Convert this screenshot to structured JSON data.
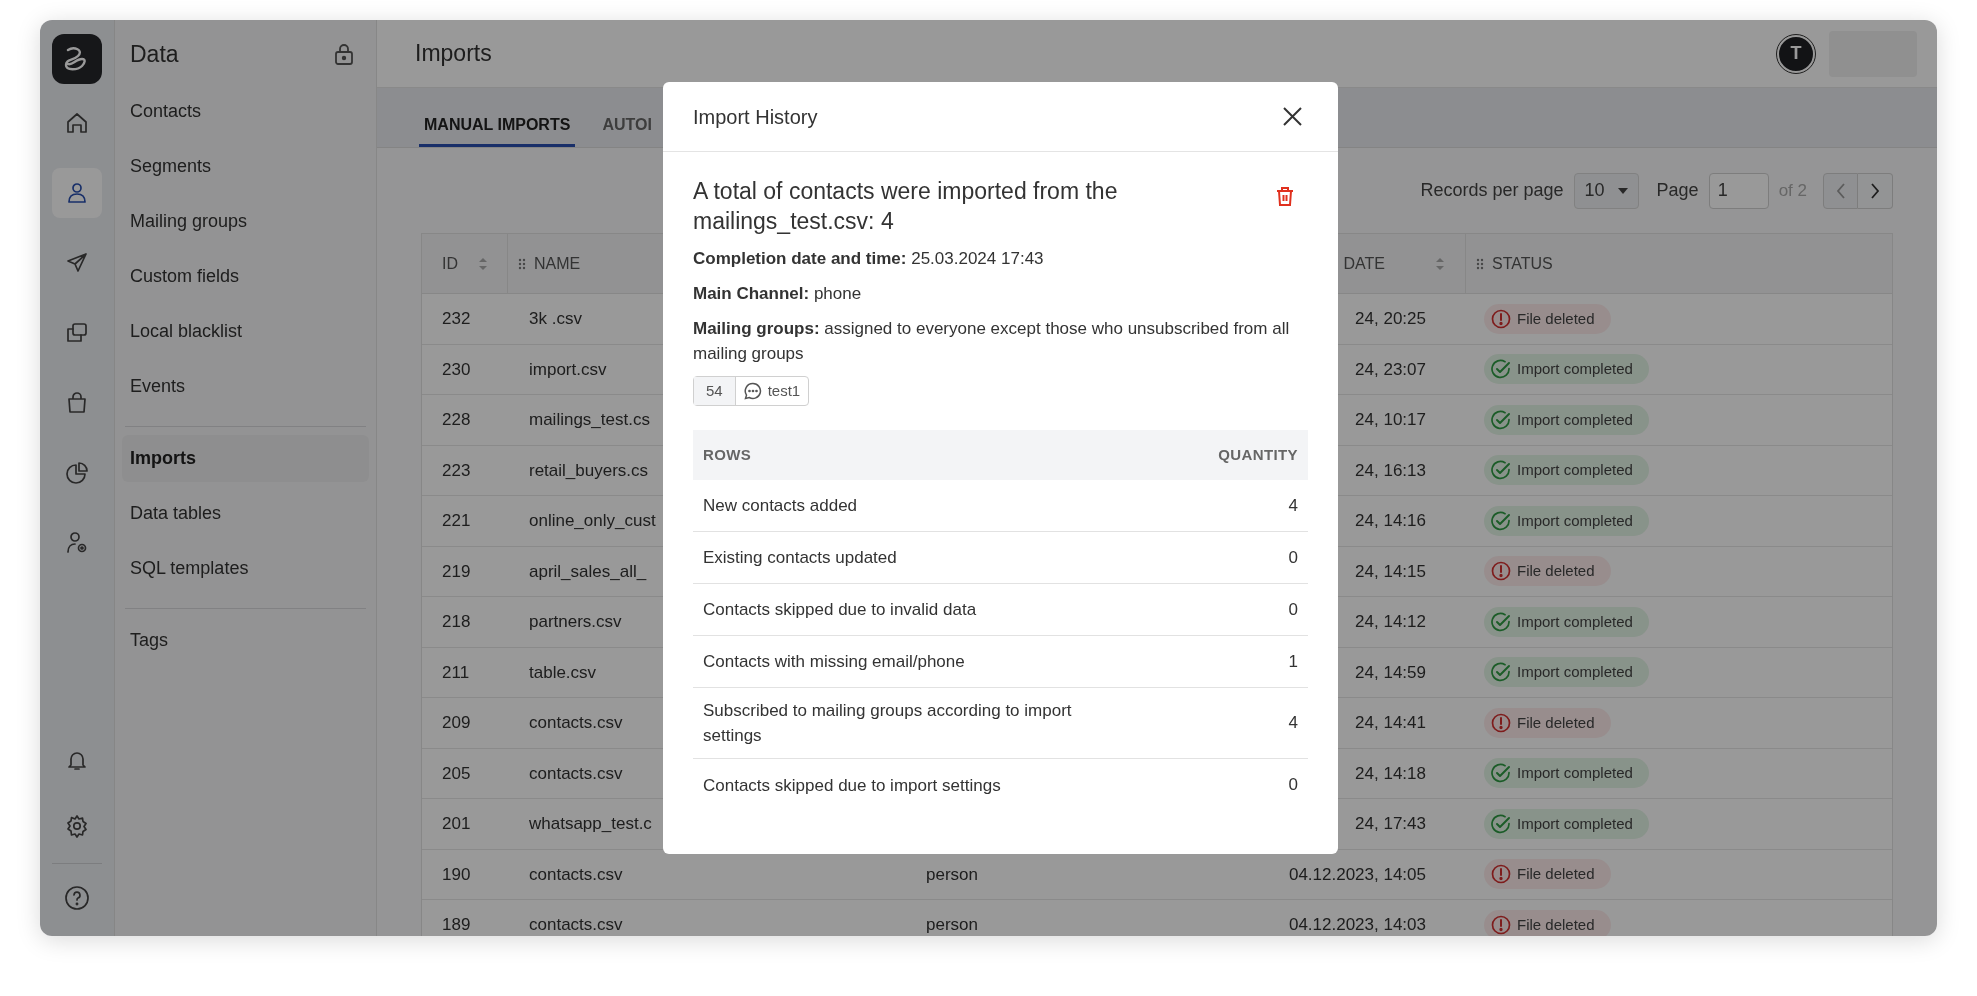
{
  "rail": {
    "items": [
      {
        "selected": false
      },
      {
        "selected": true
      },
      {
        "selected": false
      },
      {
        "selected": false
      },
      {
        "selected": false
      },
      {
        "selected": false
      },
      {
        "selected": false
      }
    ]
  },
  "sidebar": {
    "title": "Data",
    "groups": [
      {
        "items": [
          {
            "label": "Contacts",
            "selected": false
          },
          {
            "label": "Segments",
            "selected": false
          },
          {
            "label": "Mailing groups",
            "selected": false
          },
          {
            "label": "Custom fields",
            "selected": false
          },
          {
            "label": "Local blacklist",
            "selected": false
          },
          {
            "label": "Events",
            "selected": false
          }
        ]
      },
      {
        "items": [
          {
            "label": "Imports",
            "selected": true
          },
          {
            "label": "Data tables",
            "selected": false
          },
          {
            "label": "SQL templates",
            "selected": false
          }
        ]
      },
      {
        "items": [
          {
            "label": "Tags",
            "selected": false
          }
        ]
      }
    ]
  },
  "header": {
    "title": "Imports",
    "avatar": "T"
  },
  "tabs": [
    {
      "label": "MANUAL IMPORTS",
      "selected": true
    },
    {
      "label": "AUTOI",
      "selected": false
    }
  ],
  "pagination": {
    "records_label": "Records per page",
    "per_page": "10",
    "page_label": "Page",
    "page": "1",
    "of": "of 2"
  },
  "table": {
    "columns": [
      "ID",
      "NAME",
      "DATE",
      "STATUS"
    ],
    "rows": [
      {
        "id": "232",
        "name": "3k .csv",
        "date": "24, 20:25",
        "status": {
          "kind": "error",
          "label": "File deleted"
        }
      },
      {
        "id": "230",
        "name": "import.csv",
        "date": "24, 23:07",
        "status": {
          "kind": "success",
          "label": "Import completed"
        }
      },
      {
        "id": "228",
        "name": "mailings_test.cs",
        "date": "24, 10:17",
        "status": {
          "kind": "success",
          "label": "Import completed"
        }
      },
      {
        "id": "223",
        "name": "retail_buyers.cs",
        "date": "24, 16:13",
        "status": {
          "kind": "success",
          "label": "Import completed"
        }
      },
      {
        "id": "221",
        "name": "online_only_cust",
        "date": "24, 14:16",
        "status": {
          "kind": "success",
          "label": "Import completed"
        }
      },
      {
        "id": "219",
        "name": "april_sales_all_",
        "date": "24, 14:15",
        "status": {
          "kind": "error",
          "label": "File deleted"
        }
      },
      {
        "id": "218",
        "name": "partners.csv",
        "date": "24, 14:12",
        "status": {
          "kind": "success",
          "label": "Import completed"
        }
      },
      {
        "id": "211",
        "name": "table.csv",
        "date": "24, 14:59",
        "status": {
          "kind": "success",
          "label": "Import completed"
        }
      },
      {
        "id": "209",
        "name": "contacts.csv",
        "date": "24, 14:41",
        "status": {
          "kind": "error",
          "label": "File deleted"
        }
      },
      {
        "id": "205",
        "name": "contacts.csv",
        "date": "24, 14:18",
        "status": {
          "kind": "success",
          "label": "Import completed"
        }
      },
      {
        "id": "201",
        "name": "whatsapp_test.c",
        "date": "24, 17:43",
        "status": {
          "kind": "success",
          "label": "Import completed"
        }
      },
      {
        "id": "190",
        "name": "contacts.csv",
        "column_3": "person",
        "date": "04.12.2023, 14:05",
        "status": {
          "kind": "error",
          "label": "File deleted"
        }
      },
      {
        "id": "189",
        "name": "contacts.csv",
        "column_3": "person",
        "date": "04.12.2023, 14:03",
        "status": {
          "kind": "error",
          "label": "File deleted"
        }
      }
    ]
  },
  "modal": {
    "title": "Import History",
    "summary": "A total of contacts were imported from the mailings_test.csv: 4",
    "details": [
      "**Completion date and time:** 25.03.2024 17:43",
      "**Main Channel:** phone",
      "**Mailing groups:** assigned to everyone except those who unsubscribed from all mailing groups"
    ],
    "group_tag": {
      "count": "54",
      "name": "test1"
    },
    "table": {
      "columns": [
        "ROWS",
        "QUANTITY"
      ],
      "rows": [
        {
          "label": "New contacts added",
          "value": "4"
        },
        {
          "label": "Existing contacts updated",
          "value": "0"
        },
        {
          "label": "Contacts skipped due to invalid data",
          "value": "0"
        },
        {
          "label": "Contacts with missing email/phone",
          "value": "1"
        },
        {
          "label": "Subscribed to mailing groups according to import settings",
          "value": "4"
        },
        {
          "label": "Contacts skipped due to import settings",
          "value": "0"
        }
      ]
    }
  }
}
